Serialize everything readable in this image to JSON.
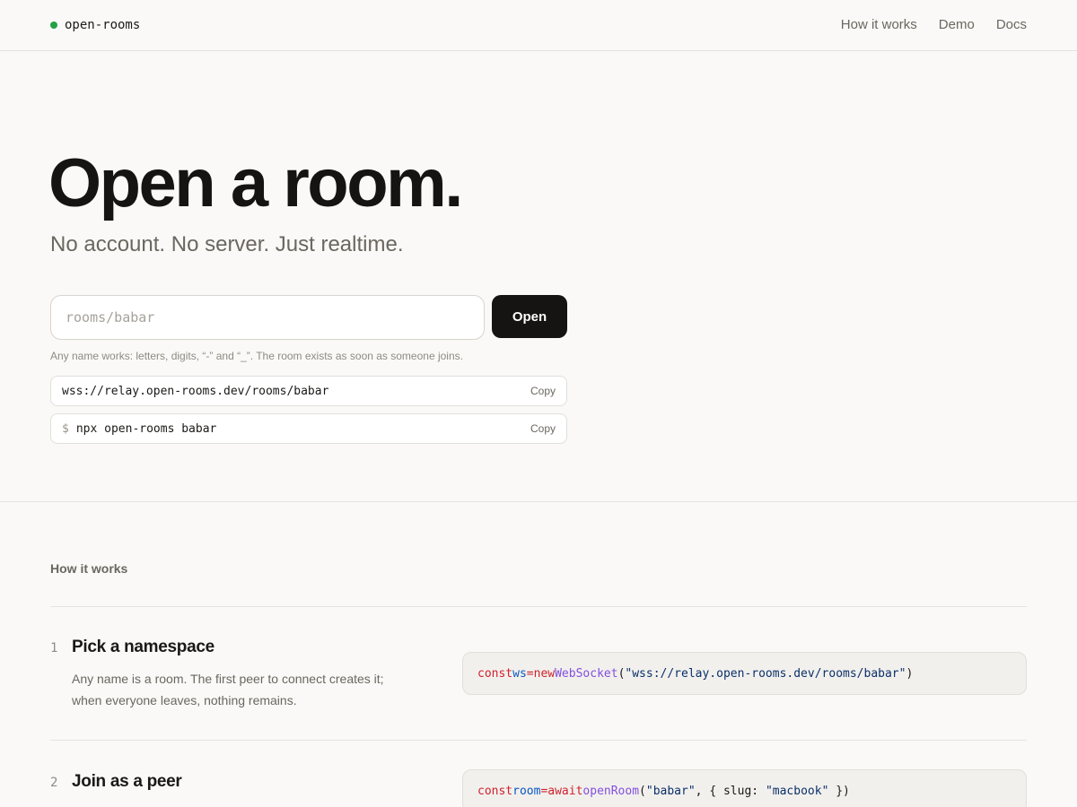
{
  "header": {
    "brand": "open-rooms",
    "nav": [
      "How it works",
      "Demo",
      "Docs"
    ]
  },
  "hero": {
    "title": "Open a room.",
    "subtitle": "No account. No server. Just realtime.",
    "input_placeholder": "rooms/babar",
    "open_label": "Open",
    "hint": "Any name works: letters, digits, “-” and “_”. The room exists as soon as someone joins.",
    "url_line": "wss://relay.open-rooms.dev/rooms/babar",
    "cli_prompt": "$",
    "cli_line": "npx open-rooms babar",
    "copy_label": "Copy"
  },
  "how": {
    "label": "How it works",
    "steps": [
      {
        "num": "1",
        "title": "Pick a namespace",
        "body": "Any name is a room. The first peer to connect creates it; when everyone leaves, nothing remains.",
        "code": {
          "kw1": "const",
          "var": "ws",
          "eq": "=",
          "kw2": "new",
          "fn": "WebSocket",
          "open": "(",
          "str": "\"wss://relay.open-rooms.dev/rooms/babar\"",
          "close": ")"
        }
      },
      {
        "num": "2",
        "title": "Join as a peer",
        "code": {
          "kw1": "const",
          "var": "room",
          "eq": "=",
          "kw2": "await",
          "fn": "openRoom",
          "open": "(",
          "str1": "\"babar\"",
          "mid": ", { slug: ",
          "str2": "\"macbook\"",
          "close": " })"
        }
      }
    ]
  },
  "colors": {
    "accent_dot": "#22a147",
    "button_bg": "#151412",
    "background": "#faf9f7"
  }
}
